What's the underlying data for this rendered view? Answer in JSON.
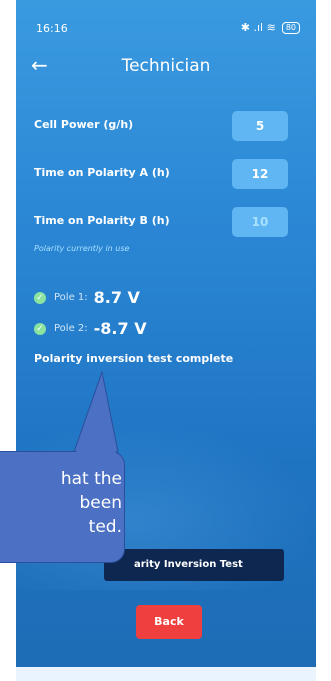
{
  "status": {
    "time": "16:16",
    "signal": "✱ .ıl ≋",
    "battery": "80"
  },
  "header": {
    "back_icon": "←",
    "title": "Technician"
  },
  "settings": [
    {
      "label": "Cell Power (g/h)",
      "value": "5"
    },
    {
      "label": "Time on Polarity A (h)",
      "value": "12"
    },
    {
      "label": "Time on Polarity B (h)",
      "value": "10"
    }
  ],
  "hint": "Polarity currently in use",
  "poles": [
    {
      "label": "Pole 1:",
      "value": "8.7 V"
    },
    {
      "label": "Pole 2:",
      "value": "-8.7 V"
    }
  ],
  "status_message": "Polarity inversion test complete",
  "buttons": {
    "test": "arity Inversion Test",
    "back": "Back"
  },
  "callout": {
    "line1": "hat the",
    "line2": "been",
    "line3": "ted."
  },
  "colors": {
    "accent": "#0d2750",
    "danger": "#ef3f3f",
    "field": "#5fb6f3",
    "callout": "#4b70c4"
  }
}
